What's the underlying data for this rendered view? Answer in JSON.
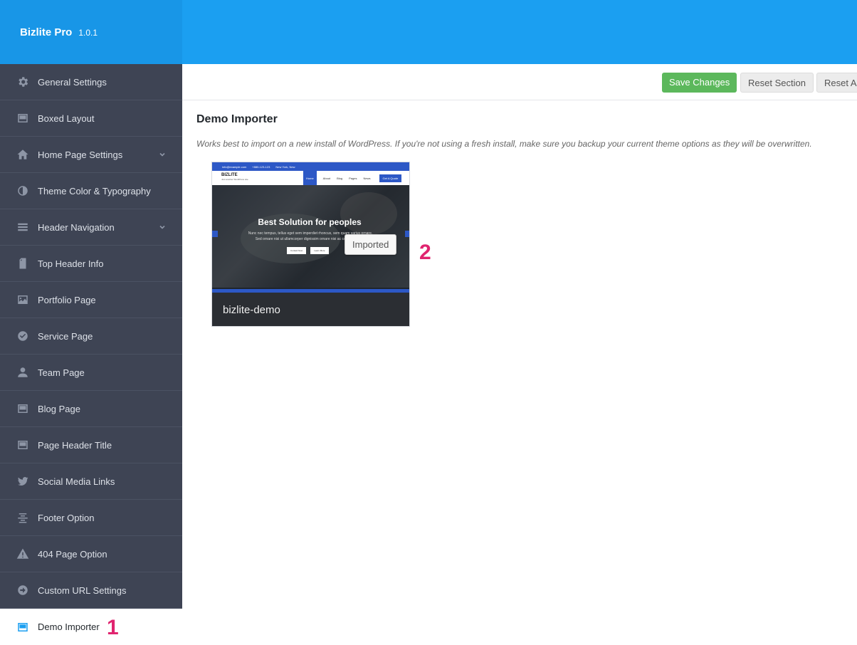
{
  "app": {
    "title": "Bizlite Pro",
    "version": "1.0.1"
  },
  "colors": {
    "topbar": "#1b9ff1",
    "sidebar": "#3e4454",
    "save": "#5cb85c",
    "marker": "#e0246f",
    "demo_accent": "#2d58c6"
  },
  "sidebar": {
    "items": [
      {
        "label": "General Settings",
        "icon": "gear-icon"
      },
      {
        "label": "Boxed Layout",
        "icon": "layout-icon"
      },
      {
        "label": "Home Page Settings",
        "icon": "home-icon",
        "has_submenu": true
      },
      {
        "label": "Theme Color & Typography",
        "icon": "contrast-icon"
      },
      {
        "label": "Header Navigation",
        "icon": "menu-icon",
        "has_submenu": true
      },
      {
        "label": "Top Header Info",
        "icon": "document-icon"
      },
      {
        "label": "Portfolio Page",
        "icon": "image-icon"
      },
      {
        "label": "Service Page",
        "icon": "check-circle-icon"
      },
      {
        "label": "Team Page",
        "icon": "person-icon"
      },
      {
        "label": "Blog Page",
        "icon": "layout-icon"
      },
      {
        "label": "Page Header Title",
        "icon": "layout-icon"
      },
      {
        "label": "Social Media Links",
        "icon": "twitter-icon"
      },
      {
        "label": "Footer Option",
        "icon": "align-center-icon"
      },
      {
        "label": "404 Page Option",
        "icon": "warning-icon"
      },
      {
        "label": "Custom URL Settings",
        "icon": "arrow-right-circle-icon"
      },
      {
        "label": "Demo Importer",
        "icon": "layout-icon",
        "active": true
      }
    ]
  },
  "toolbar": {
    "save_label": "Save Changes",
    "reset_section_label": "Reset Section",
    "reset_all_label": "Reset All"
  },
  "main": {
    "title": "Demo Importer",
    "description": "Works best to import on a new install of WordPress. If you're not using a fresh install, make sure you backup your current theme options as they will be overwritten.",
    "demo": {
      "name": "bizlite-demo",
      "status_button": "Imported",
      "preview": {
        "topbar": [
          "info@example.com",
          "+880-123-123",
          "New York, New"
        ],
        "logo": "BIZLITE",
        "tagline": "Just another WordPress site",
        "nav": [
          "Home",
          "About",
          "Blog",
          "Pages",
          "News"
        ],
        "cta": "Get A Quote",
        "hero_title": "Best Solution for peoples",
        "hero_text": "Nunc nec tempus, tellus eget sem imperdiet rhoncus, sem quam varius ornare. Sed ornare nisi ut ullamcorper dignissim ornare nisi ac convallis diam.",
        "hero_text_bold": "ordimentum rhoncus, sem quam varius",
        "buttons": [
          "Contact Now",
          "Learn More"
        ]
      }
    }
  },
  "annotations": {
    "marker_1": "1",
    "marker_2": "2"
  }
}
